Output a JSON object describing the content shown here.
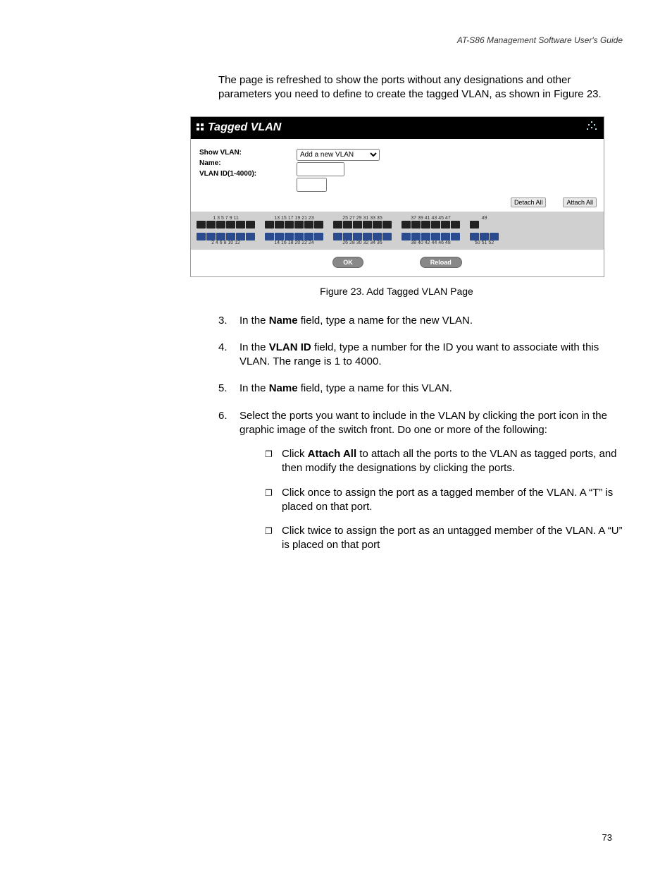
{
  "header": {
    "guide_title": "AT-S86 Management Software User's Guide"
  },
  "intro_para": "The page is refreshed to show the ports without any designations and other parameters you need to define to create the tagged VLAN, as shown in Figure 23.",
  "vlan": {
    "title": "Tagged VLAN",
    "labels": {
      "show": "Show VLAN:",
      "name": "Name:",
      "id": "VLAN ID(1-4000):"
    },
    "select_option": "Add a new VLAN",
    "detach": "Detach All",
    "attach": "Attach All",
    "ok": "OK",
    "reload": "Reload",
    "ports_top_g1": "1 3 5 7 9 11",
    "ports_bot_g1": "2 4 6 8 10 12",
    "ports_top_g2": "13 15 17 19 21 23",
    "ports_bot_g2": "14 16 18 20 22 24",
    "ports_top_g3": "25 27 29 31 33 35",
    "ports_bot_g3": "26 28 30 32 34 36",
    "ports_top_g4": "37 39 41 43 45 47",
    "ports_bot_g4": "38 40 42 44 46 48",
    "ports_top_g5": "49",
    "ports_bot_g5": "50 51 52"
  },
  "figure_caption": "Figure 23. Add Tagged VLAN Page",
  "steps": {
    "s3": {
      "num": "3.",
      "pre": "In the ",
      "bold": "Name",
      "post": " field, type a name for the new VLAN."
    },
    "s4": {
      "num": "4.",
      "pre": "In the ",
      "bold": "VLAN ID",
      "post": " field, type a number for the ID you want to associate with this VLAN. The range is 1 to 4000."
    },
    "s5": {
      "num": "5.",
      "pre": "In the ",
      "bold": "Name",
      "post": " field, type a name for this VLAN."
    },
    "s6": {
      "num": "6.",
      "text": "Select the ports you want to include in the VLAN by clicking the port icon in the graphic image of the switch front. Do one or more of the following:"
    }
  },
  "bullets": {
    "b1": {
      "pre": "Click ",
      "bold": "Attach All",
      "post": " to attach all the ports to the VLAN as tagged ports, and then modify the designations by clicking the ports."
    },
    "b2": "Click once to assign the port as a tagged member of the VLAN. A “T” is placed on that port.",
    "b3": "Click twice to assign the port as an untagged member of the VLAN. A “U” is placed on that port"
  },
  "page_number": "73"
}
